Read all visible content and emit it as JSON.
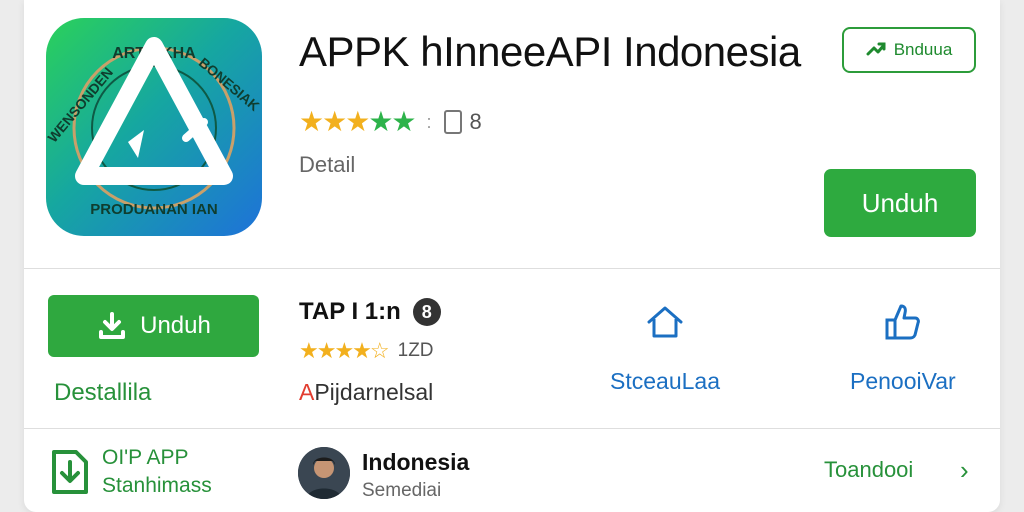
{
  "header": {
    "title": "APPK hInneeAPI Indonesia",
    "badge_label": "Bnduua",
    "stars": "★★★",
    "stars_green": "★★",
    "separator": ":",
    "rating_count": "8",
    "detail_label": "Detail",
    "primary_button": "Unduh"
  },
  "app_icon": {
    "ring_text_top": "ARTRIKHA",
    "ring_text_right": "BONESIAK",
    "ring_text_left": "WENSONDEN",
    "ring_text_bottom": "PRODUANAN IAN"
  },
  "row2": {
    "download_button": "Unduh",
    "details_link": "Destallila",
    "app_name": "TAP I 1:n",
    "app_name_icon": "8",
    "stars": "★★★★☆",
    "rating_count": "1ZD",
    "apps_link_initial": "A",
    "apps_link_rest": "Pijdarnelsal",
    "nav_home_label": "StceauLaa",
    "nav_like_label": "PenooiVar"
  },
  "row3": {
    "line1": "OI'P APP",
    "line2": "Stanhimass",
    "user_name": "Indonesia",
    "user_sub": "Semediai",
    "link_label": "Toandooi",
    "chevron": "›"
  },
  "colors": {
    "accent_green": "#2eaa3f",
    "link_blue": "#1b6fc2",
    "star_gold": "#f2b01e"
  }
}
